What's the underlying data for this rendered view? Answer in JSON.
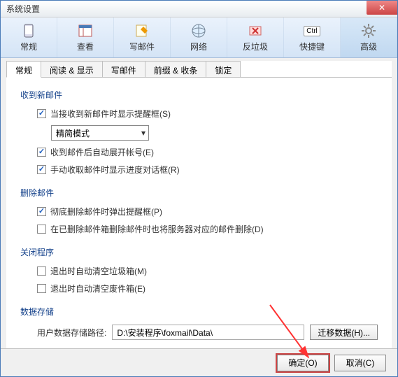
{
  "window": {
    "title": "系统设置"
  },
  "toolbar": {
    "items": [
      {
        "label": "常规"
      },
      {
        "label": "查看"
      },
      {
        "label": "写邮件"
      },
      {
        "label": "网络"
      },
      {
        "label": "反垃圾"
      },
      {
        "label": "快捷键",
        "badge": "Ctrl"
      },
      {
        "label": "高级"
      }
    ]
  },
  "tabs": [
    {
      "label": "常规"
    },
    {
      "label": "阅读 & 显示"
    },
    {
      "label": "写邮件"
    },
    {
      "label": "前缀 & 收条"
    },
    {
      "label": "锁定"
    }
  ],
  "sections": {
    "receive": {
      "title": "收到新邮件",
      "opt1": "当接收到新邮件时显示提醒框(S)",
      "dropdown": "精简模式",
      "opt2": "收到邮件后自动展开帐号(E)",
      "opt3": "手动收取邮件时显示进度对话框(R)"
    },
    "delete": {
      "title": "删除邮件",
      "opt1": "彻底删除邮件时弹出提醒框(P)",
      "opt2": "在已删除邮件箱删除邮件时也将服务器对应的邮件删除(D)"
    },
    "close": {
      "title": "关闭程序",
      "opt1": "退出时自动清空垃圾箱(M)",
      "opt2": "退出时自动清空废件箱(E)"
    },
    "storage": {
      "title": "数据存储",
      "path_label": "用户数据存储路径:",
      "path_value": "D:\\安装程序\\foxmail\\Data\\",
      "migrate_btn": "迁移数据(H)..."
    }
  },
  "footer": {
    "ok": "确定(O)",
    "cancel": "取消(C)"
  }
}
